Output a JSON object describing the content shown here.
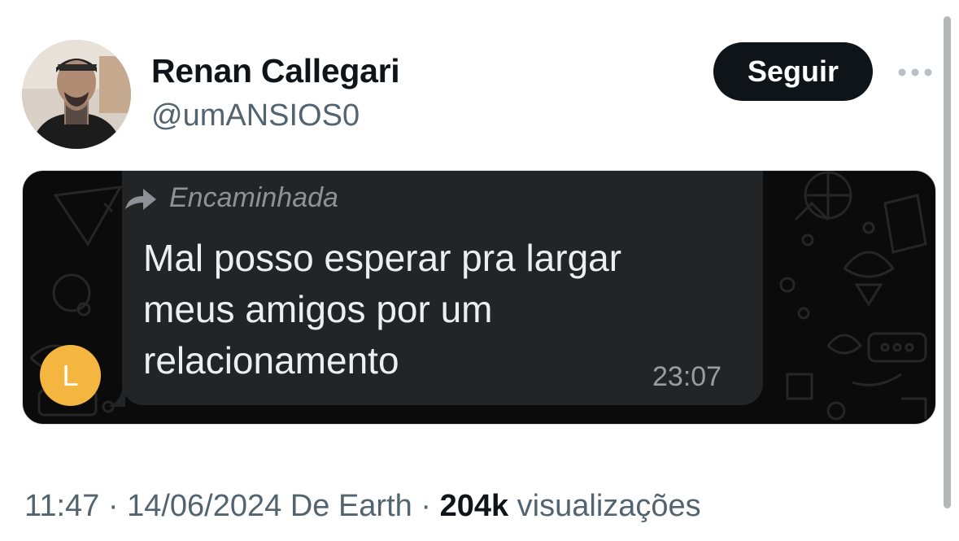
{
  "tweet": {
    "display_name": "Renan Callegari",
    "handle": "@umANSIOS0",
    "follow_label": "Seguir",
    "more_icon": "more-horizontal-icon",
    "time": "11:47",
    "date": "14/06/2024",
    "source": "De Earth",
    "separator": "·",
    "views_count": "204k",
    "views_label": "visualizações"
  },
  "media": {
    "forwarded_label": "Encaminhada",
    "forward_icon": "forward-arrow-icon",
    "message_lines": [
      "Mal posso esperar pra largar",
      "meus amigos por um",
      "relacionamento"
    ],
    "message_time": "23:07",
    "sender_initial": "L",
    "colors": {
      "bubble": "#222425",
      "chat_background": "#0b0b0b",
      "sender_avatar": "#f4b63f"
    }
  },
  "colors": {
    "primary_text": "#0f1419",
    "secondary_text": "#536471",
    "follow_button": "#0f1419"
  }
}
